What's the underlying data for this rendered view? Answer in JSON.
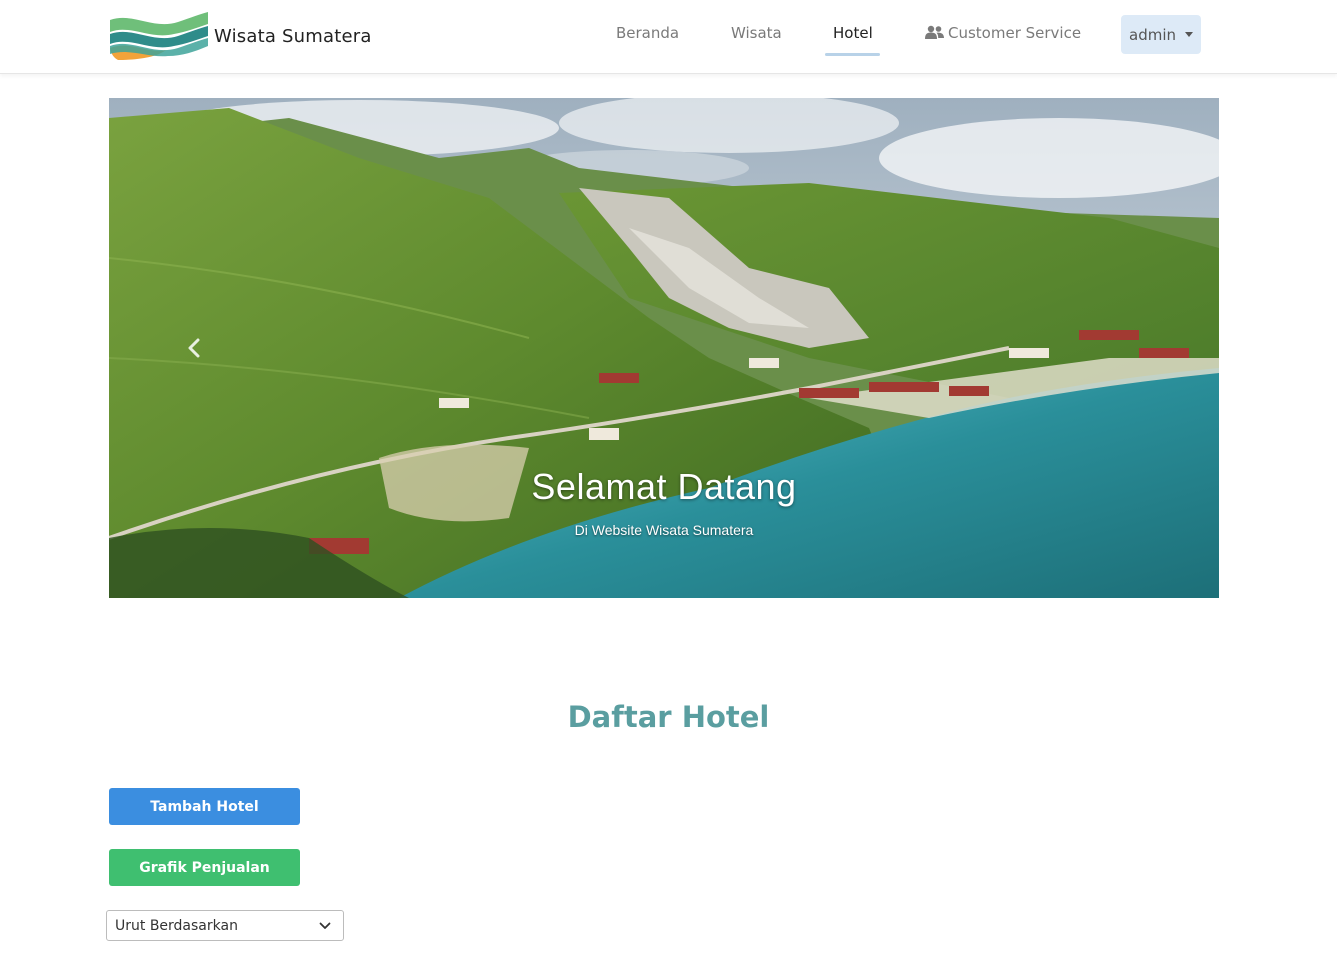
{
  "brand": {
    "name": "Wisata Sumatera",
    "logo_icon": "wave-logo-icon"
  },
  "nav": {
    "items": [
      {
        "label": "Beranda"
      },
      {
        "label": "Wisata"
      },
      {
        "label": "Hotel",
        "active": true
      },
      {
        "label": "Customer Service",
        "icon": "users-icon"
      }
    ],
    "user_menu": {
      "label": "admin",
      "icon": "caret-down-icon"
    }
  },
  "hero": {
    "title": "Selamat Datang",
    "subtitle": "Di Website Wisata Sumatera",
    "prev_icon": "chevron-left-icon"
  },
  "section": {
    "title": "Daftar Hotel",
    "add_button": "Tambah Hotel",
    "chart_button": "Grafik Penjualan",
    "sort_select": {
      "value": "Urut Berdasarkan",
      "icon": "chevron-down-icon"
    }
  },
  "colors": {
    "accent_blue": "#3b8ee0",
    "accent_green": "#3fbf70",
    "title_teal": "#5a9ea0",
    "user_menu_bg": "#ddeaf7"
  }
}
